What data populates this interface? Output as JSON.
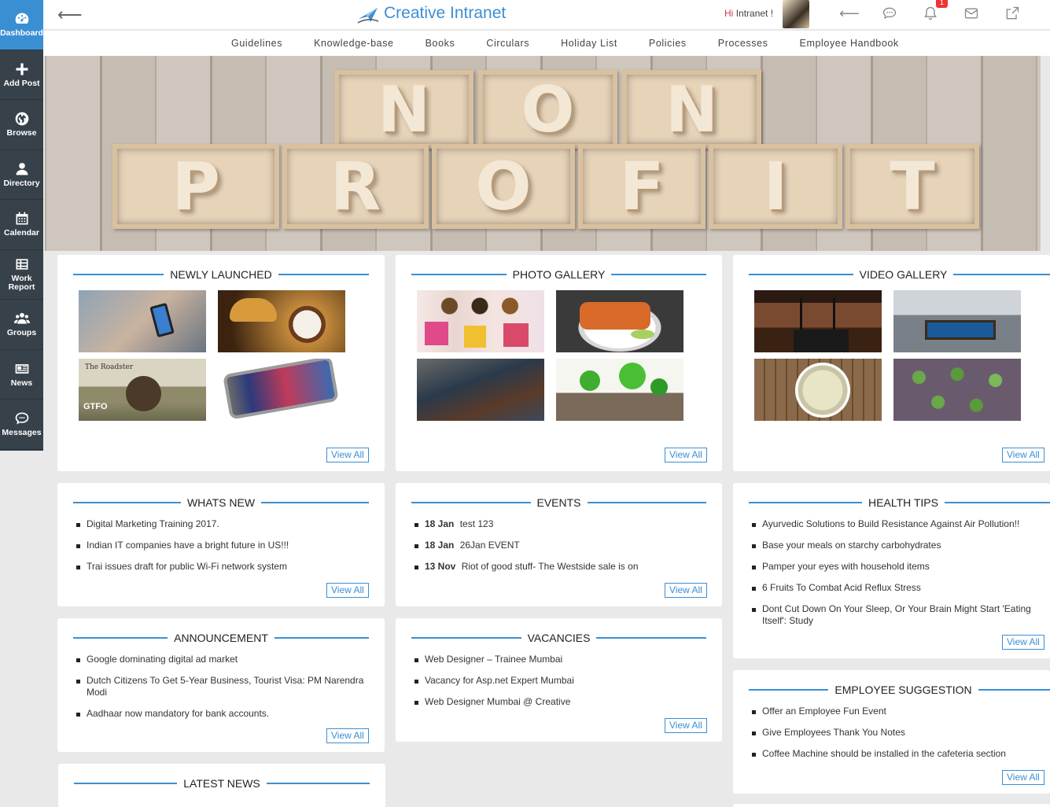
{
  "sidebar": {
    "items": [
      {
        "label": "Dashboard",
        "icon": "dashboard-icon"
      },
      {
        "label": "Add Post",
        "icon": "plus-icon"
      },
      {
        "label": "Browse",
        "icon": "globe-icon"
      },
      {
        "label": "Directory",
        "icon": "user-icon"
      },
      {
        "label": "Calendar",
        "icon": "calendar-icon"
      },
      {
        "label": "Work Report",
        "icon": "table-icon"
      },
      {
        "label": "Groups",
        "icon": "group-icon"
      },
      {
        "label": "News",
        "icon": "newspaper-icon"
      },
      {
        "label": "Messages",
        "icon": "chat-icon"
      }
    ]
  },
  "header": {
    "brand": "Creative Intranet",
    "greeting_hi": "Hi",
    "greeting_name": "Intranet !",
    "notification_count": "1"
  },
  "nav": [
    "Guidelines",
    "Knowledge-base",
    "Books",
    "Circulars",
    "Holiday List",
    "Policies",
    "Processes",
    "Employee Handbook"
  ],
  "banner": {
    "word1": [
      "N",
      "O",
      "N"
    ],
    "word2": [
      "P",
      "R",
      "O",
      "F",
      "I",
      "T"
    ]
  },
  "view_all_label": "View All",
  "newly_launched": {
    "title": "NEWLY LAUNCHED",
    "thumbs": [
      "phone-in-hand",
      "croissant-coffee",
      "retro-motorbike-poster",
      "smartphone"
    ]
  },
  "photo_gallery": {
    "title": "PHOTO GALLERY",
    "thumbs": [
      "shopping-women",
      "food-platter",
      "cyclists",
      "green-balloons-party"
    ]
  },
  "video_gallery": {
    "title": "VIDEO GALLERY",
    "thumbs": [
      "conference-microphones",
      "office-pool-table",
      "sprouts-bowl",
      "plant-wall"
    ]
  },
  "whats_new": {
    "title": "WHATS NEW",
    "items": [
      "Digital Marketing Training 2017.",
      "Indian IT companies have a bright future in US!!!",
      "Trai issues draft for public Wi-Fi network system"
    ]
  },
  "events": {
    "title": "EVENTS",
    "items": [
      {
        "date": "18 Jan",
        "text": "test 123"
      },
      {
        "date": "18 Jan",
        "text": "26Jan EVENT"
      },
      {
        "date": "13 Nov",
        "text": "Riot of good stuff- The Westside sale is on"
      }
    ]
  },
  "health_tips": {
    "title": "HEALTH TIPS",
    "items": [
      "Ayurvedic Solutions to Build Resistance Against Air Pollution!!",
      "Base your meals on starchy carbohydrates",
      "Pamper your eyes with household items",
      "6 Fruits To Combat Acid Reflux Stress",
      "Dont Cut Down On Your Sleep, Or Your Brain Might Start 'Eating Itself': Study"
    ]
  },
  "announcement": {
    "title": "ANNOUNCEMENT",
    "items": [
      "Google dominating digital ad market",
      "Dutch Citizens To Get 5-Year Business, Tourist Visa: PM Narendra Modi",
      "Aadhaar now mandatory for bank accounts."
    ]
  },
  "vacancies": {
    "title": "VACANCIES",
    "items": [
      "Web Designer – Trainee Mumbai",
      "Vacancy for Asp.net Expert Mumbai",
      "Web Designer Mumbai @ Creative"
    ]
  },
  "employee_suggestion": {
    "title": "EMPLOYEE SUGGESTION",
    "items": [
      "Offer an Employee Fun Event",
      "Give Employees Thank You Notes",
      "Coffee Machine should be installed in the cafeteria section"
    ]
  },
  "latest_news": {
    "title": "LATEST NEWS"
  }
}
